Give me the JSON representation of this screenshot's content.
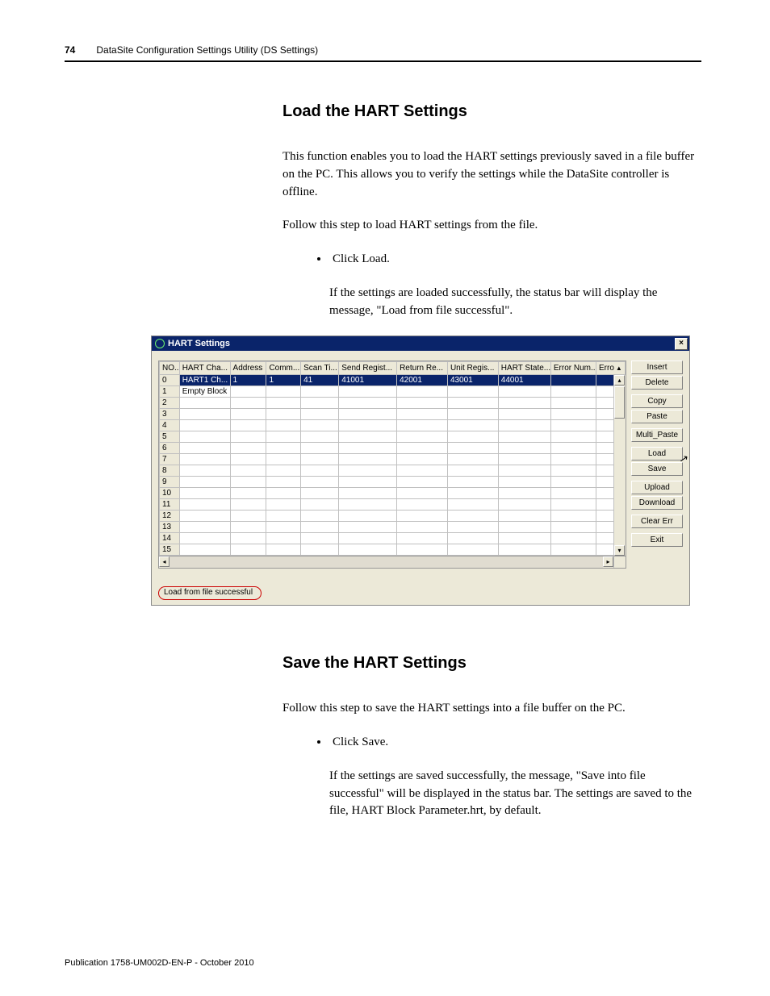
{
  "header": {
    "page_number": "74",
    "title": "DataSite Configuration Settings Utility (DS Settings)"
  },
  "section1": {
    "heading": "Load the HART Settings",
    "p1": "This function enables you to load the HART settings previously saved in a file buffer on the PC. This allows you to verify the settings while the DataSite controller is offline.",
    "p2": "Follow this step to load HART settings from the file.",
    "bullet": "Click Load.",
    "after": "If the settings are loaded successfully, the status bar will display the message, \"Load from file successful\"."
  },
  "hart_window": {
    "title": "HART Settings",
    "close_glyph": "×",
    "columns": [
      "NO...",
      "HART Cha...",
      "Address",
      "Comm...",
      "Scan Ti...",
      "Send Regist...",
      "Return Re...",
      "Unit Regis...",
      "HART State...",
      "Error Num...",
      "Erro"
    ],
    "rows": [
      {
        "no": "0",
        "hart": "HART1 Ch...",
        "addr": "1",
        "comm": "1",
        "scan": "41",
        "send": "41001",
        "ret": "42001",
        "unit": "43001",
        "state": "44001",
        "errn": "",
        "erro": ""
      },
      {
        "no": "1",
        "hart": "Empty Block",
        "addr": "",
        "comm": "",
        "scan": "",
        "send": "",
        "ret": "",
        "unit": "",
        "state": "",
        "errn": "",
        "erro": ""
      },
      {
        "no": "2"
      },
      {
        "no": "3"
      },
      {
        "no": "4"
      },
      {
        "no": "5"
      },
      {
        "no": "6"
      },
      {
        "no": "7"
      },
      {
        "no": "8"
      },
      {
        "no": "9"
      },
      {
        "no": "10"
      },
      {
        "no": "11"
      },
      {
        "no": "12"
      },
      {
        "no": "13"
      },
      {
        "no": "14"
      },
      {
        "no": "15"
      }
    ],
    "buttons": [
      "Insert",
      "Delete",
      "Copy",
      "Paste",
      "Multi_Paste",
      "Load",
      "Save",
      "Upload",
      "Download",
      "Clear Err",
      "Exit"
    ],
    "status": "Load from file successful",
    "sort_glyph": "▲",
    "up": "▴",
    "down": "▾",
    "left": "◂",
    "right": "▸",
    "cursor": "↖"
  },
  "section2": {
    "heading": "Save the HART Settings",
    "p1": "Follow this step to save the HART settings into a file buffer on the PC.",
    "bullet": "Click Save.",
    "after": "If the settings are saved successfully, the message, \"Save into file successful\" will be displayed in the status bar. The settings are saved to the file, HART Block Parameter.hrt, by default."
  },
  "footer": "Publication 1758-UM002D-EN-P - October 2010"
}
